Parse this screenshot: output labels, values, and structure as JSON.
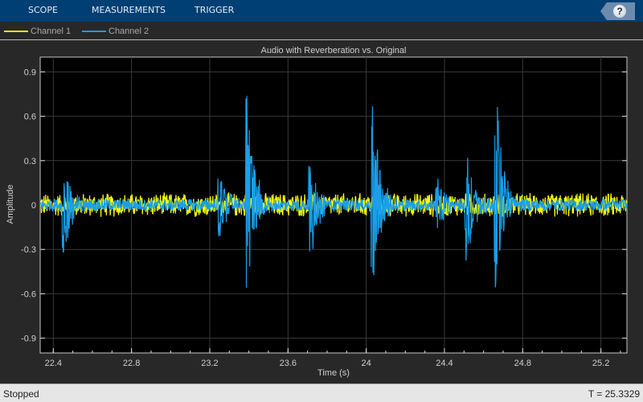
{
  "toolstrip": {
    "tabs": [
      "SCOPE",
      "MEASUREMENTS",
      "TRIGGER"
    ],
    "help_label": "?"
  },
  "legend": [
    {
      "label": "Channel 1",
      "color": "#ffff00"
    },
    {
      "label": "Channel 2",
      "color": "#1a9fe8"
    }
  ],
  "status": {
    "state": "Stopped",
    "time": "T = 25.3329"
  },
  "chart_data": {
    "type": "line",
    "title": "Audio with Reverberation vs. Original",
    "xlabel": "Time (s)",
    "ylabel": "Amplitude",
    "xlim": [
      22.333,
      25.333
    ],
    "ylim": [
      -1,
      1
    ],
    "xticks": [
      "22.4",
      "22.8",
      "23.2",
      "23.6",
      "24",
      "24.4",
      "24.8",
      "25.2"
    ],
    "xtick_values": [
      22.4,
      22.8,
      23.2,
      23.6,
      24,
      24.4,
      24.8,
      25.2
    ],
    "yticks": [
      "0.9",
      "0.6",
      "0.3",
      "0",
      "-0.3",
      "-0.6",
      "-0.9"
    ],
    "ytick_values": [
      0.9,
      0.6,
      0.3,
      0,
      -0.3,
      -0.6,
      -0.9
    ],
    "grid": true,
    "series": [
      {
        "name": "Channel 1",
        "color": "#ffff00",
        "noise_amplitude": 0.08
      },
      {
        "name": "Channel 2",
        "color": "#1a9fe8",
        "noise_amplitude": 0.04,
        "bursts": [
          {
            "t": 22.45,
            "max": 0.3,
            "min": -0.42
          },
          {
            "t": 23.245,
            "max": 0.25,
            "min": -0.27
          },
          {
            "t": 23.39,
            "max": 0.84,
            "min": -0.6
          },
          {
            "t": 23.71,
            "max": 0.3,
            "min": -0.43
          },
          {
            "t": 24.03,
            "max": 0.8,
            "min": -0.67
          },
          {
            "t": 24.36,
            "max": 0.2,
            "min": -0.19
          },
          {
            "t": 24.51,
            "max": 0.4,
            "min": -0.42
          },
          {
            "t": 24.66,
            "max": 0.92,
            "min": -0.6
          }
        ]
      }
    ]
  }
}
